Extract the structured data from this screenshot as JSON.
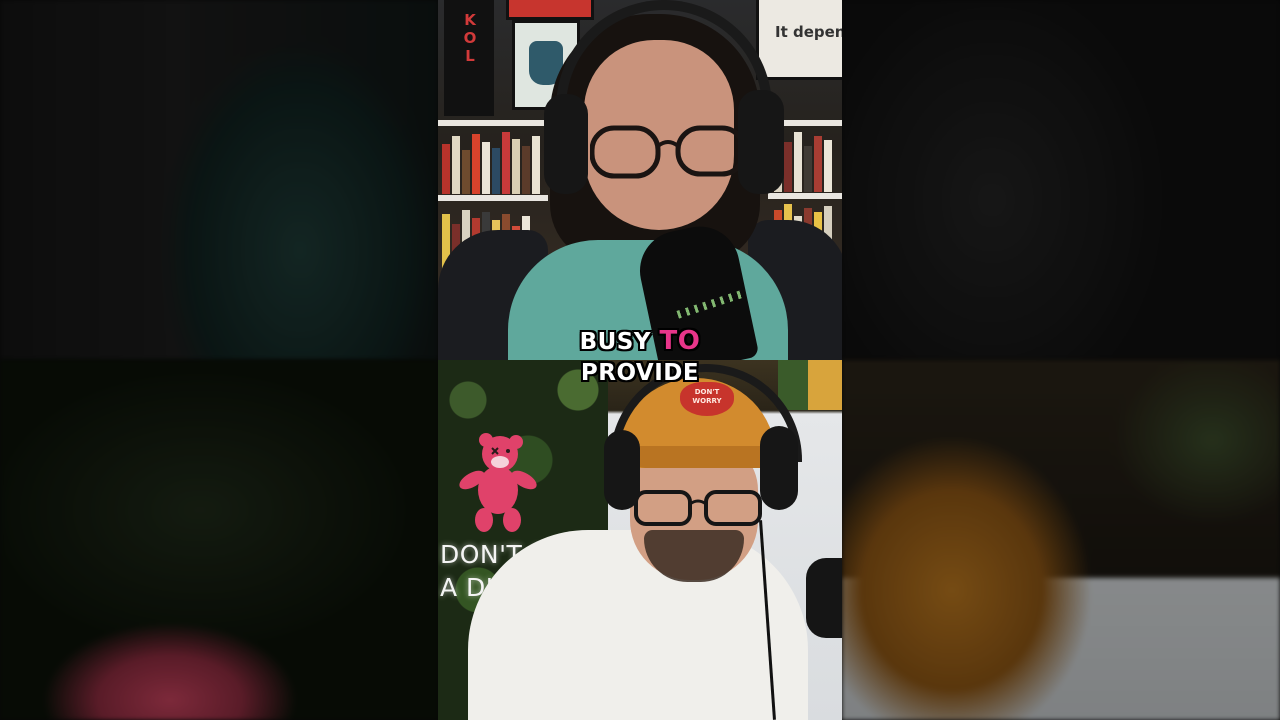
{
  "video": {
    "layout": "two stacked webcam panels with blurred side fill",
    "caption": {
      "line1_word1": "BUSY",
      "line1_word2": "TO",
      "line2": "PROVIDE",
      "highlight_color": "#e8358a",
      "text_color": "#ffffff"
    },
    "top_panel": {
      "poster_text": "It depen",
      "poster_vertical_text": "KOL"
    },
    "bottom_panel": {
      "neon_sign_line1": "DON'T BE",
      "neon_sign_line2": "A DICK",
      "cap_patch_text": "DON'T WORRY"
    }
  }
}
